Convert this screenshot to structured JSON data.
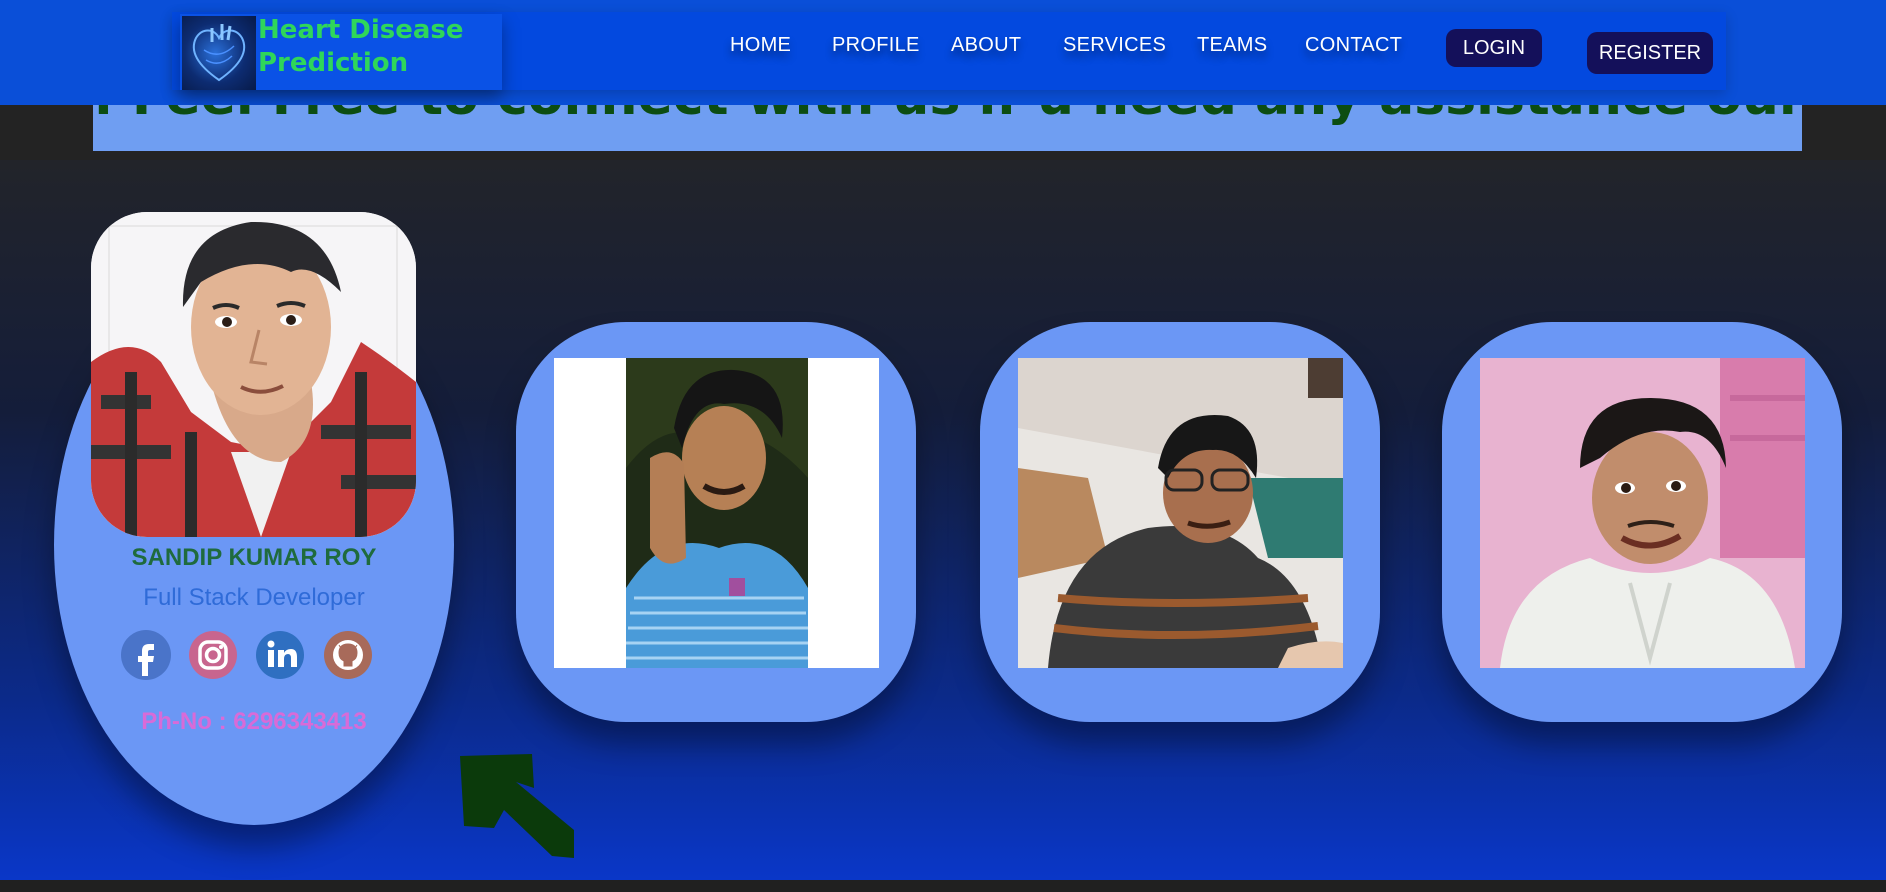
{
  "brand": {
    "title": "Heart Disease Prediction",
    "logo_icon": "heart-anatomy-icon"
  },
  "nav": {
    "links": [
      "HOME",
      "PROFILE",
      "ABOUT",
      "SERVICES",
      "TEAMS",
      "CONTACT"
    ],
    "login": "LOGIN",
    "register": "REGISTER"
  },
  "banner": {
    "text": ": Feel Free to connect with us if u need any assistance our tea"
  },
  "team": {
    "featured": {
      "name": "SANDIP KUMAR ROY",
      "role": "Full Stack Developer",
      "phone": "Ph-No : 6296343413",
      "socials": [
        "facebook-icon",
        "instagram-icon",
        "linkedin-icon",
        "github-icon"
      ]
    },
    "members_count_shown": 3
  },
  "colors": {
    "navbar": "#0a4fd8",
    "brand_text": "#2fd65a",
    "card": "#6b97f5",
    "name_text": "#1f6b3d",
    "role_text": "#2f6bd8",
    "phone_text": "#d86bd8",
    "button_dark": "#14105a"
  }
}
